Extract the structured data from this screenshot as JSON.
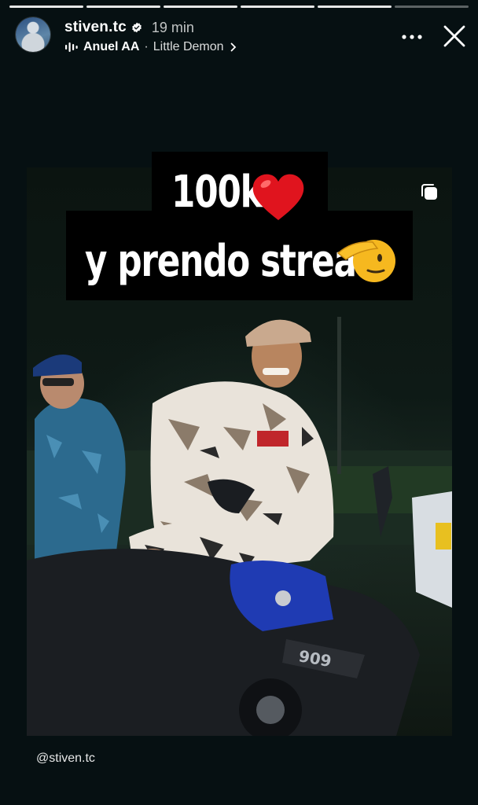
{
  "progress": {
    "segments": 6,
    "completed": 5
  },
  "header": {
    "username": "stiven.tc",
    "time": "19 min",
    "music": {
      "artist": "Anuel AA",
      "separator": "·",
      "song": "Little Demon"
    }
  },
  "story": {
    "caption_line1": "100k",
    "caption_line2": "y prendo stream",
    "mention": "@stiven.tc"
  },
  "icons": {
    "verified": "verified-badge-icon",
    "music": "audio-waveform-icon",
    "more": "more-horizontal-icon",
    "close": "close-icon",
    "heart": "red-heart-emoji",
    "salute": "saluting-face-emoji",
    "stack": "multiple-photos-icon"
  }
}
